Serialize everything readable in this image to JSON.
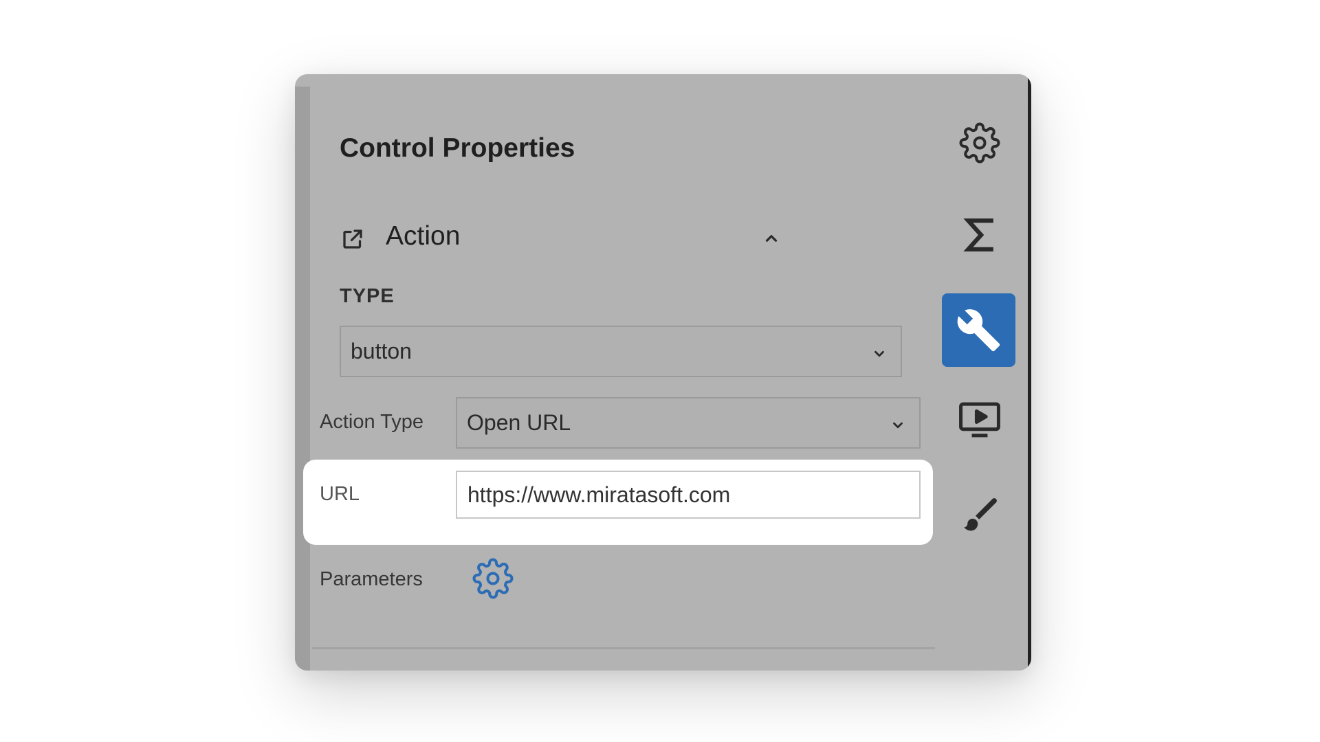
{
  "panel": {
    "title": "Control Properties",
    "section": {
      "title": "Action",
      "icon": "open-external-icon",
      "collapse_icon": "chevron-up-icon"
    },
    "type": {
      "label": "TYPE",
      "value": "button"
    },
    "action_type": {
      "label": "Action Type",
      "value": "Open URL"
    },
    "url": {
      "label": "URL",
      "value": "https://www.miratasoft.com"
    },
    "parameters": {
      "label": "Parameters",
      "icon": "gear-icon"
    }
  },
  "sidebar": {
    "items": [
      {
        "name": "settings",
        "icon": "gear-icon",
        "active": false
      },
      {
        "name": "formulas",
        "icon": "sigma-icon",
        "active": false
      },
      {
        "name": "properties",
        "icon": "wrench-icon",
        "active": true
      },
      {
        "name": "preview",
        "icon": "play-screen-icon",
        "active": false
      },
      {
        "name": "style",
        "icon": "paintbrush-icon",
        "active": false
      }
    ]
  },
  "colors": {
    "accent": "#2b6cb5",
    "overlay": "#b3b3b3",
    "highlight": "#ffffff"
  }
}
